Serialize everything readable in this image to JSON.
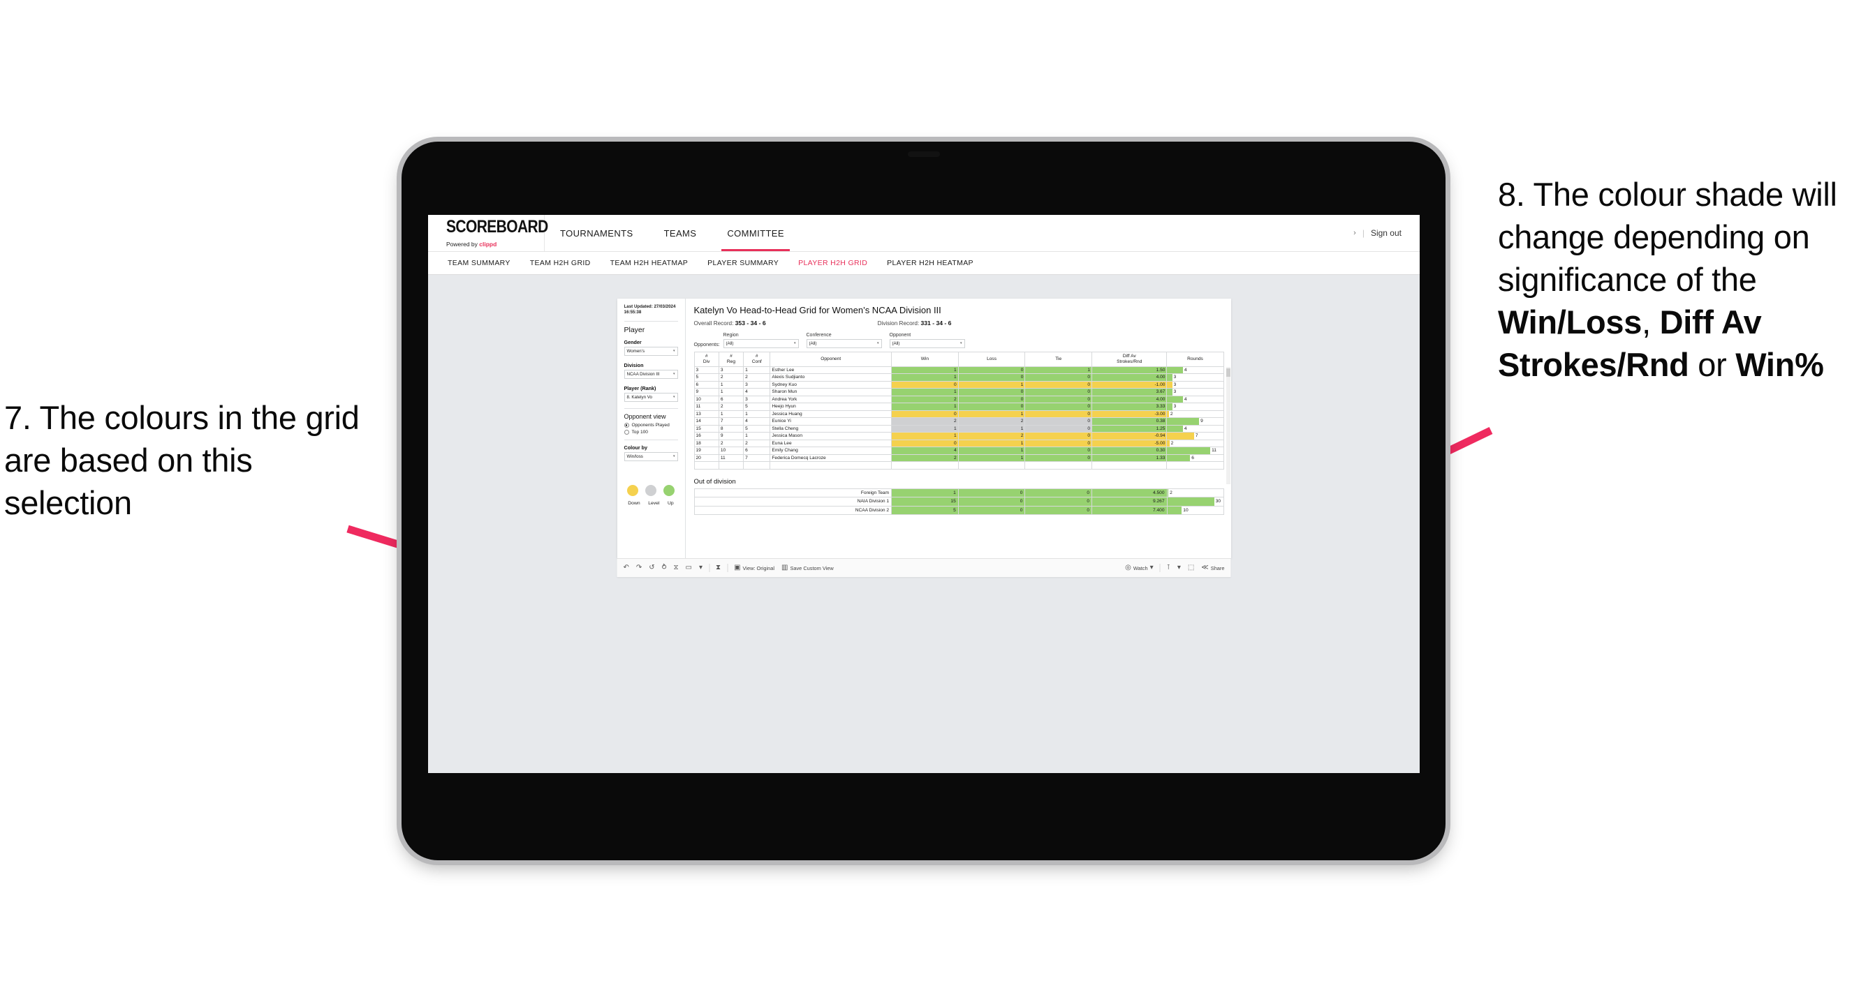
{
  "annotations": {
    "left": "7. The colours in the grid are based on this selection",
    "right_parts": [
      {
        "t": "8. The colour shade will change depending on significance of the ",
        "b": false
      },
      {
        "t": "Win/Loss",
        "b": true
      },
      {
        "t": ", ",
        "b": false
      },
      {
        "t": "Diff Av Strokes/Rnd",
        "b": true
      },
      {
        "t": " or ",
        "b": false
      },
      {
        "t": "Win%",
        "b": true
      }
    ],
    "arrow_color": "#ef2a5f"
  },
  "app": {
    "brand_title": "SCOREBOARD",
    "brand_sub_prefix": "Powered by ",
    "brand_sub_name": "clippd",
    "top_nav": [
      {
        "label": "TOURNAMENTS",
        "active": false
      },
      {
        "label": "TEAMS",
        "active": false
      },
      {
        "label": "COMMITTEE",
        "active": true
      }
    ],
    "chevron": "›",
    "separator": "|",
    "sign_out": "Sign out",
    "sub_nav": [
      {
        "label": "TEAM SUMMARY",
        "active": false
      },
      {
        "label": "TEAM H2H GRID",
        "active": false
      },
      {
        "label": "TEAM H2H HEATMAP",
        "active": false
      },
      {
        "label": "PLAYER SUMMARY",
        "active": false
      },
      {
        "label": "PLAYER H2H GRID",
        "active": true
      },
      {
        "label": "PLAYER H2H HEATMAP",
        "active": false
      }
    ],
    "accent": "#e8305a"
  },
  "panel": {
    "last_updated": "Last Updated: 27/03/2024 16:55:38",
    "section_player": "Player",
    "gender_label": "Gender",
    "gender_value": "Women’s",
    "division_label": "Division",
    "division_value": "NCAA Division III",
    "player_label": "Player (Rank)",
    "player_value": "8. Katelyn Vo",
    "opponent_view_label": "Opponent view",
    "opponent_view_options": [
      {
        "label": "Opponents Played",
        "selected": true
      },
      {
        "label": "Top 100",
        "selected": false
      }
    ],
    "colour_by_label": "Colour by",
    "colour_by_value": "Win/loss",
    "legend": [
      {
        "label": "Down",
        "color": "#f5d14e"
      },
      {
        "label": "Level",
        "color": "#cfd0d2"
      },
      {
        "label": "Up",
        "color": "#97d270"
      }
    ],
    "caret": "▾"
  },
  "content": {
    "title": "Katelyn Vo Head-to-Head Grid for Women’s NCAA Division III",
    "overall_record_label": "Overall Record: ",
    "overall_record_value": "353 -  34 - 6",
    "division_record_label": "Division Record: ",
    "division_record_value": "331 -  34 - 6",
    "opponents_label": "Opponents:",
    "filters": [
      {
        "label": "Region",
        "value": "(All)"
      },
      {
        "label": "Conference",
        "value": "(All)"
      },
      {
        "label": "Opponent",
        "value": "(All)"
      }
    ],
    "columns": [
      "# Div",
      "# Reg",
      "# Conf",
      "Opponent",
      "Win",
      "Loss",
      "Tie",
      "Diff Av Strokes/Rnd",
      "Rounds"
    ],
    "col_header_lines": [
      [
        "#",
        "Div"
      ],
      [
        "#",
        "Reg"
      ],
      [
        "#",
        "Conf"
      ],
      [
        "Opponent"
      ],
      [
        "Win"
      ],
      [
        "Loss"
      ],
      [
        "Tie"
      ],
      [
        "Diff Av",
        "Strokes/Rnd"
      ],
      [
        "Rounds"
      ]
    ],
    "rows": [
      {
        "div": "3",
        "reg": "3",
        "conf": "1",
        "opponent": "Esther Lee",
        "win": "1",
        "loss": "0",
        "tie": "1",
        "diff": "1.50",
        "rounds": "4",
        "shade": "green",
        "bar_pct": 28
      },
      {
        "div": "5",
        "reg": "2",
        "conf": "2",
        "opponent": "Alexis Sudjianto",
        "win": "1",
        "loss": "0",
        "tie": "0",
        "diff": "4.00",
        "rounds": "3",
        "shade": "green",
        "bar_pct": 9
      },
      {
        "div": "6",
        "reg": "1",
        "conf": "3",
        "opponent": "Sydney Kuo",
        "win": "0",
        "loss": "1",
        "tie": "0",
        "diff": "-1.00",
        "rounds": "3",
        "shade": "yellow",
        "bar_pct": 9
      },
      {
        "div": "9",
        "reg": "1",
        "conf": "4",
        "opponent": "Sharon Mun",
        "win": "1",
        "loss": "0",
        "tie": "0",
        "diff": "3.67",
        "rounds": "3",
        "shade": "green",
        "bar_pct": 9
      },
      {
        "div": "10",
        "reg": "6",
        "conf": "3",
        "opponent": "Andrea York",
        "win": "2",
        "loss": "0",
        "tie": "0",
        "diff": "4.00",
        "rounds": "4",
        "shade": "green",
        "bar_pct": 28
      },
      {
        "div": "11",
        "reg": "2",
        "conf": "5",
        "opponent": "Heejo Hyun",
        "win": "1",
        "loss": "0",
        "tie": "0",
        "diff": "3.33",
        "rounds": "3",
        "shade": "green",
        "bar_pct": 9
      },
      {
        "div": "13",
        "reg": "1",
        "conf": "1",
        "opponent": "Jessica Huang",
        "win": "0",
        "loss": "1",
        "tie": "0",
        "diff": "-3.00",
        "rounds": "2",
        "shade": "yellow",
        "bar_pct": 3
      },
      {
        "div": "14",
        "reg": "7",
        "conf": "4",
        "opponent": "Eunice Yi",
        "win": "2",
        "loss": "2",
        "tie": "0",
        "diff": "0.38",
        "rounds": "9",
        "shade": "grey",
        "diff_shade": "green",
        "bar_pct": 57
      },
      {
        "div": "15",
        "reg": "8",
        "conf": "5",
        "opponent": "Stella Cheng",
        "win": "1",
        "loss": "1",
        "tie": "0",
        "diff": "1.25",
        "rounds": "4",
        "shade": "grey",
        "diff_shade": "green",
        "bar_pct": 28
      },
      {
        "div": "16",
        "reg": "9",
        "conf": "1",
        "opponent": "Jessica Mason",
        "win": "1",
        "loss": "2",
        "tie": "0",
        "diff": "-0.94",
        "rounds": "7",
        "shade": "yellow",
        "bar_pct": 48
      },
      {
        "div": "18",
        "reg": "2",
        "conf": "2",
        "opponent": "Euna Lee",
        "win": "0",
        "loss": "1",
        "tie": "0",
        "diff": "-5.00",
        "rounds": "2",
        "shade": "yellow",
        "bar_pct": 4
      },
      {
        "div": "19",
        "reg": "10",
        "conf": "6",
        "opponent": "Emily Chang",
        "win": "4",
        "loss": "1",
        "tie": "0",
        "diff": "0.30",
        "rounds": "11",
        "shade": "green",
        "bar_pct": 77
      },
      {
        "div": "20",
        "reg": "11",
        "conf": "7",
        "opponent": "Federica Domecq Lacroze",
        "win": "2",
        "loss": "1",
        "tie": "0",
        "diff": "1.33",
        "rounds": "6",
        "shade": "green",
        "bar_pct": 41
      }
    ],
    "out_of_division_label": "Out of division",
    "out_of_division_rows": [
      {
        "label": "Foreign Team",
        "win": "1",
        "loss": "0",
        "tie": "0",
        "diff": "4.500",
        "rounds": "2",
        "shade": "green",
        "bar_pct": 2
      },
      {
        "label": "NAIA Division 1",
        "win": "15",
        "loss": "0",
        "tie": "0",
        "diff": "9.267",
        "rounds": "30",
        "shade": "green",
        "bar_pct": 84
      },
      {
        "label": "NCAA Division 2",
        "win": "5",
        "loss": "0",
        "tie": "0",
        "diff": "7.400",
        "rounds": "10",
        "shade": "green",
        "bar_pct": 26
      }
    ]
  },
  "toolbar": {
    "icons": [
      "undo-icon",
      "redo-icon",
      "revert-icon",
      "refresh-data-icon",
      "pause-updates-icon",
      "device-layout-icon",
      "caret-icon"
    ],
    "glyphs": {
      "undo": "↶",
      "redo": "↷",
      "revert": "↺",
      "refresh": "⥁",
      "pause": "⧖",
      "device": "▭",
      "caret": "▾",
      "history": "⧗",
      "view": "▣",
      "save": "▥",
      "watch": "◎",
      "download": "⊺",
      "fullscreen": "⬚",
      "share": "≪"
    },
    "view_label": "View: Original",
    "save_label": "Save Custom View",
    "watch_label": "Watch",
    "share_label": "Share"
  }
}
